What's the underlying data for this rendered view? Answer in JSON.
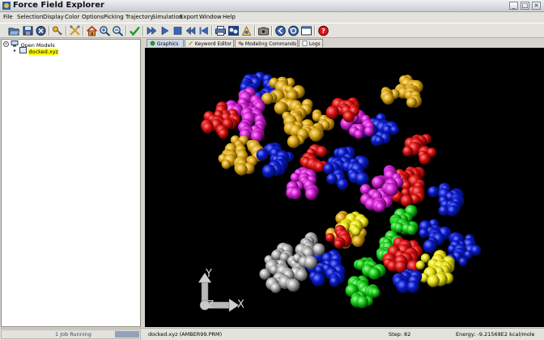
{
  "window": {
    "title": "Force Field Explorer",
    "minimize": "_",
    "maximize": "□",
    "close": "×"
  },
  "menu": [
    "File",
    "Selection",
    "Display",
    "Color",
    "Options",
    "Picking",
    "Trajectory",
    "Simulation",
    "Export",
    "Window",
    "Help"
  ],
  "tree": {
    "root": "Open Models",
    "file": "docked.xyz"
  },
  "tabs": [
    "Graphics",
    "Keyword Editor",
    "Modeling Commands",
    "Logs"
  ],
  "axes": {
    "y": "Y",
    "z": "Z",
    "x": "X"
  },
  "status": {
    "jobs": "1 Job Running",
    "file": "docked.xyz (AMBER99.PRM)",
    "step": "Step: 82",
    "energy": "Energy: -9.21569E2 kcal/mole"
  },
  "colors": {
    "blue": "#0a18c8",
    "red": "#d81010",
    "magenta": "#d020d0",
    "gold": "#d9a514",
    "green": "#18c818",
    "yellow": "#e8e010",
    "gray": "#a8a8a8"
  }
}
